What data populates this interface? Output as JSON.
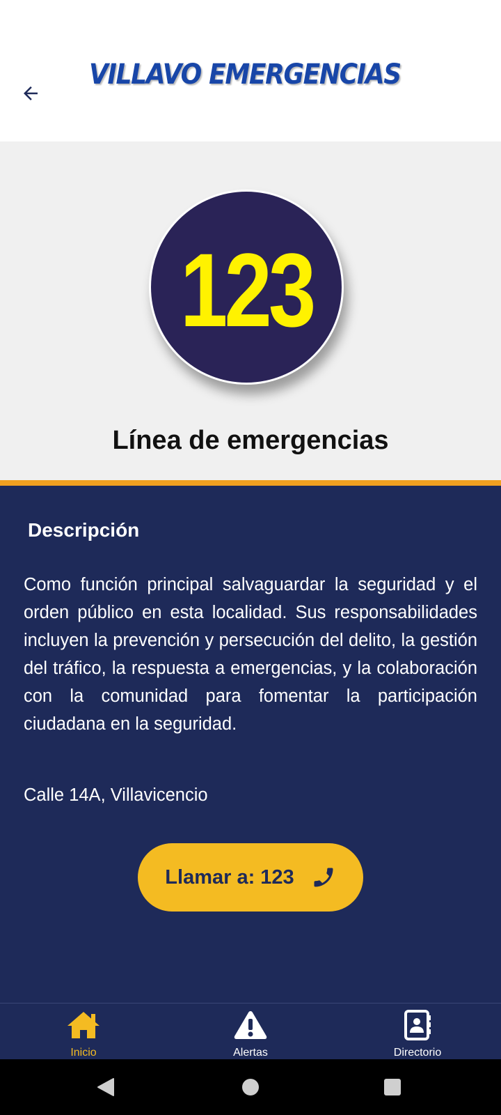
{
  "header": {
    "title": "VILLAVO EMERGENCIAS",
    "back_icon": "arrow-left-icon"
  },
  "hero": {
    "logo_number": "123",
    "title": "Línea de emergencias"
  },
  "details": {
    "heading": "Descripción",
    "description": "Como función principal salvaguardar la seguridad y el orden público en esta localidad. Sus responsabilidades incluyen la prevención y persecución del delito, la gestión del tráfico, la respuesta a emergencias, y la colaboración con la comunidad para fomentar la participación ciudadana en la seguridad.",
    "address": "Calle 14A, Villavicencio",
    "call_button_label": "Llamar a: 123",
    "call_icon": "phone-icon"
  },
  "bottom_nav": {
    "items": [
      {
        "label": "Inicio",
        "icon": "home-icon",
        "active": true
      },
      {
        "label": "Alertas",
        "icon": "warning-icon",
        "active": false
      },
      {
        "label": "Directorio",
        "icon": "contacts-book-icon",
        "active": false
      }
    ]
  },
  "system_nav": {
    "buttons": [
      "back-triangle-icon",
      "home-circle-icon",
      "recents-square-icon"
    ]
  },
  "colors": {
    "title_blue": "#1846a8",
    "navy": "#1e2a59",
    "accent_yellow": "#f4bb22",
    "accent_orange": "#f0a020",
    "logo_circle": "#2a2357",
    "logo_digits": "#fff200"
  }
}
